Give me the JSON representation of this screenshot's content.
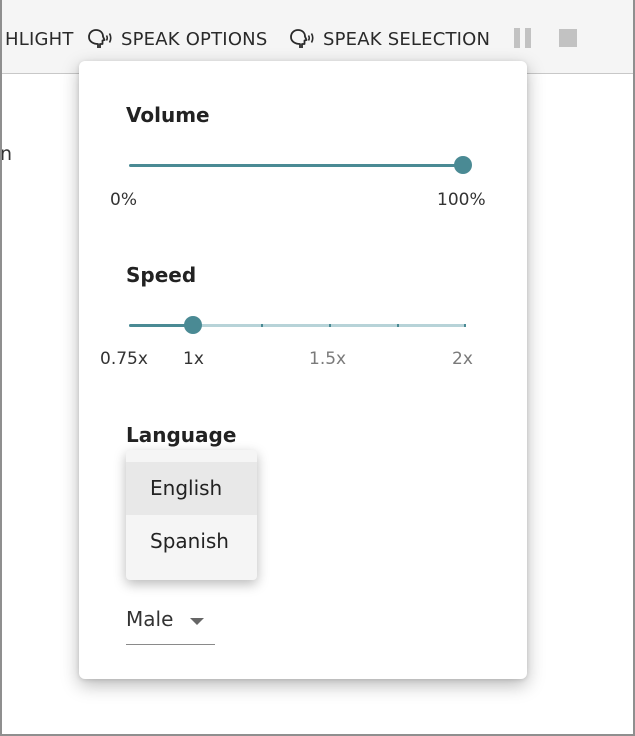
{
  "toolbar": {
    "highlight_label": "HLIGHT",
    "speak_options_label": "SPEAK OPTIONS",
    "speak_selection_label": "SPEAK SELECTION"
  },
  "background": {
    "partial_text": "n"
  },
  "panel": {
    "volume": {
      "heading": "Volume",
      "min_label": "0%",
      "max_label": "100%",
      "value_fraction": 1.0
    },
    "speed": {
      "heading": "Speed",
      "labels": [
        "0.75x",
        "1x",
        "1.5x",
        "2x"
      ],
      "value": "1x"
    },
    "language": {
      "heading": "Language",
      "options": [
        "English",
        "Spanish"
      ],
      "highlighted": "English"
    },
    "voice": {
      "selected": "Male"
    }
  },
  "colors": {
    "accent": "#4a8a94",
    "accent_light": "#b7d3d8",
    "toolbar_bg": "#f5f5f5",
    "disabled_icon": "#c2c2c2"
  }
}
